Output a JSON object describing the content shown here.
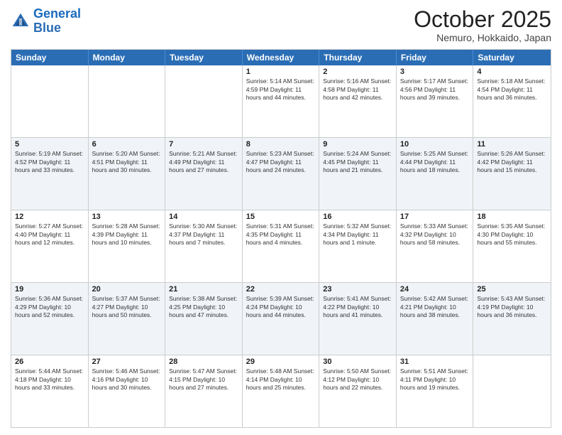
{
  "logo": {
    "line1": "General",
    "line2": "Blue"
  },
  "header": {
    "month": "October 2025",
    "location": "Nemuro, Hokkaido, Japan"
  },
  "weekdays": [
    "Sunday",
    "Monday",
    "Tuesday",
    "Wednesday",
    "Thursday",
    "Friday",
    "Saturday"
  ],
  "rows": [
    {
      "alt": false,
      "cells": [
        {
          "day": "",
          "info": ""
        },
        {
          "day": "",
          "info": ""
        },
        {
          "day": "",
          "info": ""
        },
        {
          "day": "1",
          "info": "Sunrise: 5:14 AM\nSunset: 4:59 PM\nDaylight: 11 hours and 44 minutes."
        },
        {
          "day": "2",
          "info": "Sunrise: 5:16 AM\nSunset: 4:58 PM\nDaylight: 11 hours and 42 minutes."
        },
        {
          "day": "3",
          "info": "Sunrise: 5:17 AM\nSunset: 4:56 PM\nDaylight: 11 hours and 39 minutes."
        },
        {
          "day": "4",
          "info": "Sunrise: 5:18 AM\nSunset: 4:54 PM\nDaylight: 11 hours and 36 minutes."
        }
      ]
    },
    {
      "alt": true,
      "cells": [
        {
          "day": "5",
          "info": "Sunrise: 5:19 AM\nSunset: 4:52 PM\nDaylight: 11 hours and 33 minutes."
        },
        {
          "day": "6",
          "info": "Sunrise: 5:20 AM\nSunset: 4:51 PM\nDaylight: 11 hours and 30 minutes."
        },
        {
          "day": "7",
          "info": "Sunrise: 5:21 AM\nSunset: 4:49 PM\nDaylight: 11 hours and 27 minutes."
        },
        {
          "day": "8",
          "info": "Sunrise: 5:23 AM\nSunset: 4:47 PM\nDaylight: 11 hours and 24 minutes."
        },
        {
          "day": "9",
          "info": "Sunrise: 5:24 AM\nSunset: 4:45 PM\nDaylight: 11 hours and 21 minutes."
        },
        {
          "day": "10",
          "info": "Sunrise: 5:25 AM\nSunset: 4:44 PM\nDaylight: 11 hours and 18 minutes."
        },
        {
          "day": "11",
          "info": "Sunrise: 5:26 AM\nSunset: 4:42 PM\nDaylight: 11 hours and 15 minutes."
        }
      ]
    },
    {
      "alt": false,
      "cells": [
        {
          "day": "12",
          "info": "Sunrise: 5:27 AM\nSunset: 4:40 PM\nDaylight: 11 hours and 12 minutes."
        },
        {
          "day": "13",
          "info": "Sunrise: 5:28 AM\nSunset: 4:39 PM\nDaylight: 11 hours and 10 minutes."
        },
        {
          "day": "14",
          "info": "Sunrise: 5:30 AM\nSunset: 4:37 PM\nDaylight: 11 hours and 7 minutes."
        },
        {
          "day": "15",
          "info": "Sunrise: 5:31 AM\nSunset: 4:35 PM\nDaylight: 11 hours and 4 minutes."
        },
        {
          "day": "16",
          "info": "Sunrise: 5:32 AM\nSunset: 4:34 PM\nDaylight: 11 hours and 1 minute."
        },
        {
          "day": "17",
          "info": "Sunrise: 5:33 AM\nSunset: 4:32 PM\nDaylight: 10 hours and 58 minutes."
        },
        {
          "day": "18",
          "info": "Sunrise: 5:35 AM\nSunset: 4:30 PM\nDaylight: 10 hours and 55 minutes."
        }
      ]
    },
    {
      "alt": true,
      "cells": [
        {
          "day": "19",
          "info": "Sunrise: 5:36 AM\nSunset: 4:29 PM\nDaylight: 10 hours and 52 minutes."
        },
        {
          "day": "20",
          "info": "Sunrise: 5:37 AM\nSunset: 4:27 PM\nDaylight: 10 hours and 50 minutes."
        },
        {
          "day": "21",
          "info": "Sunrise: 5:38 AM\nSunset: 4:25 PM\nDaylight: 10 hours and 47 minutes."
        },
        {
          "day": "22",
          "info": "Sunrise: 5:39 AM\nSunset: 4:24 PM\nDaylight: 10 hours and 44 minutes."
        },
        {
          "day": "23",
          "info": "Sunrise: 5:41 AM\nSunset: 4:22 PM\nDaylight: 10 hours and 41 minutes."
        },
        {
          "day": "24",
          "info": "Sunrise: 5:42 AM\nSunset: 4:21 PM\nDaylight: 10 hours and 38 minutes."
        },
        {
          "day": "25",
          "info": "Sunrise: 5:43 AM\nSunset: 4:19 PM\nDaylight: 10 hours and 36 minutes."
        }
      ]
    },
    {
      "alt": false,
      "cells": [
        {
          "day": "26",
          "info": "Sunrise: 5:44 AM\nSunset: 4:18 PM\nDaylight: 10 hours and 33 minutes."
        },
        {
          "day": "27",
          "info": "Sunrise: 5:46 AM\nSunset: 4:16 PM\nDaylight: 10 hours and 30 minutes."
        },
        {
          "day": "28",
          "info": "Sunrise: 5:47 AM\nSunset: 4:15 PM\nDaylight: 10 hours and 27 minutes."
        },
        {
          "day": "29",
          "info": "Sunrise: 5:48 AM\nSunset: 4:14 PM\nDaylight: 10 hours and 25 minutes."
        },
        {
          "day": "30",
          "info": "Sunrise: 5:50 AM\nSunset: 4:12 PM\nDaylight: 10 hours and 22 minutes."
        },
        {
          "day": "31",
          "info": "Sunrise: 5:51 AM\nSunset: 4:11 PM\nDaylight: 10 hours and 19 minutes."
        },
        {
          "day": "",
          "info": ""
        }
      ]
    }
  ]
}
